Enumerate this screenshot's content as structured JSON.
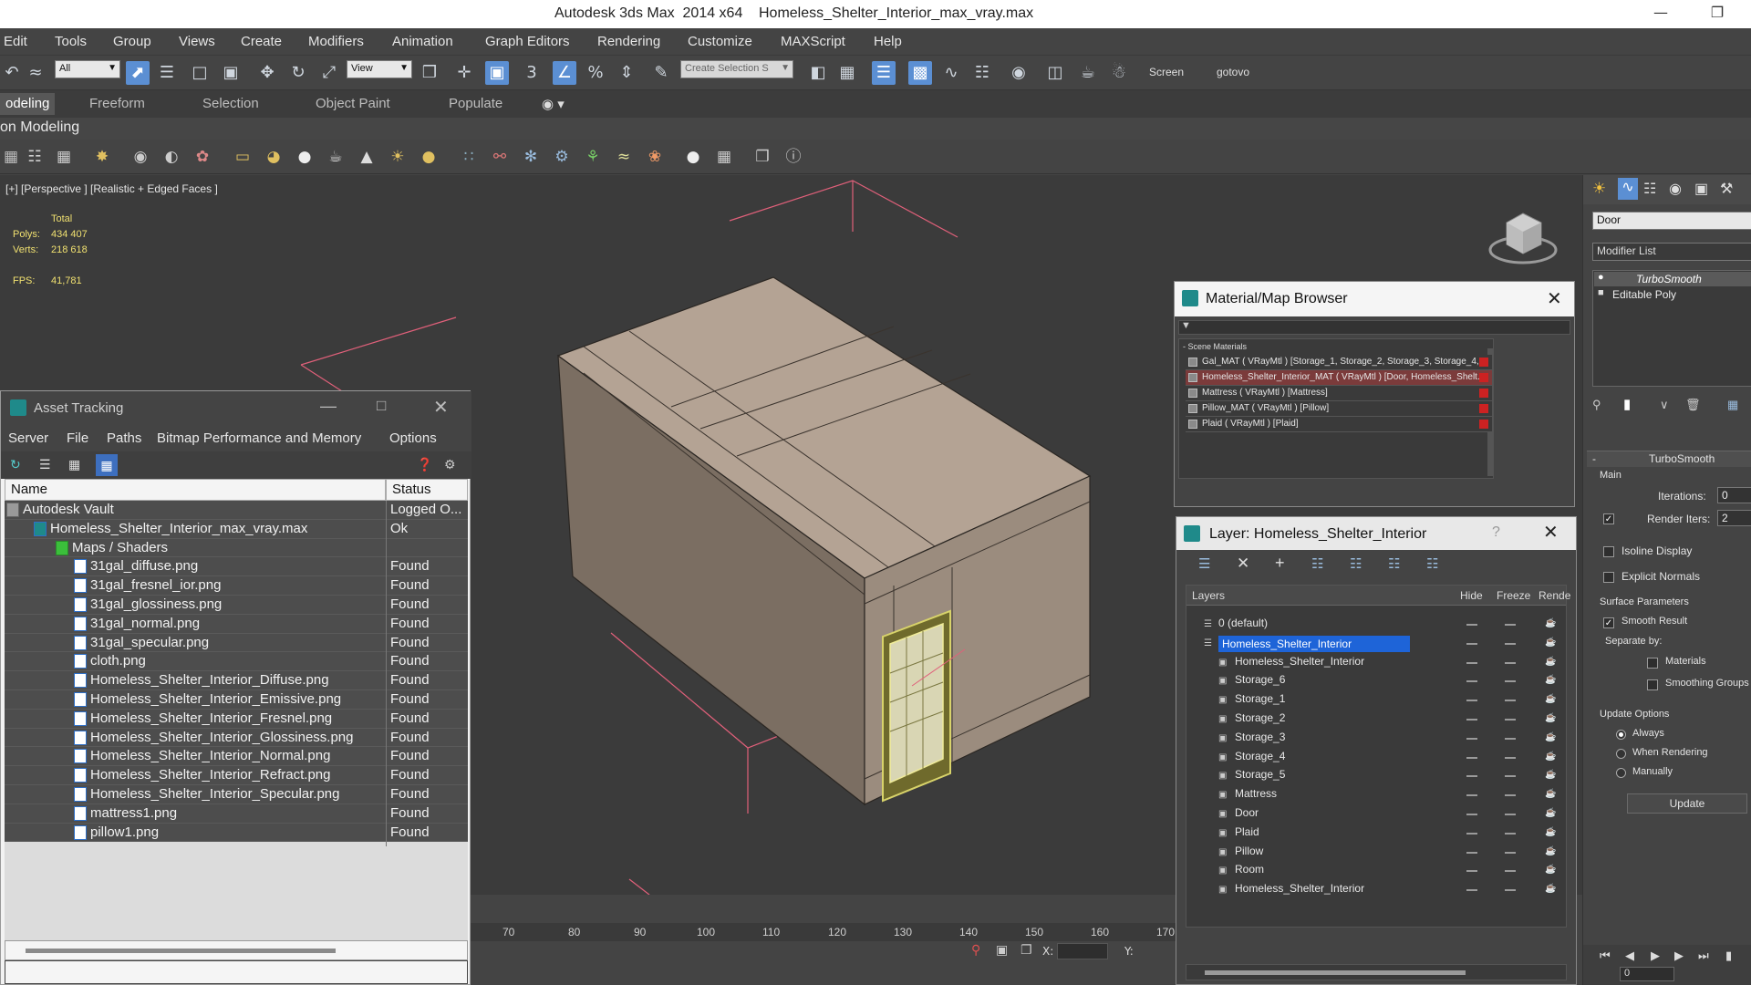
{
  "window": {
    "app_title": "Autodesk 3ds Max  2014 x64",
    "file_title": "Homeless_Shelter_Interior_max_vray.max"
  },
  "menu": [
    "Edit",
    "Tools",
    "Group",
    "Views",
    "Create",
    "Modifiers",
    "Animation",
    "Graph Editors",
    "Rendering",
    "Customize",
    "MAXScript",
    "Help"
  ],
  "toolbar": {
    "filter_value": "All",
    "refcoord_value": "View",
    "selection_set_placeholder": "Create Selection S",
    "screen_label": "Screen",
    "gotovo_label": "gotovo"
  },
  "ribbon": {
    "tabs": [
      "odeling",
      "Freeform",
      "Selection",
      "Object Paint",
      "Populate"
    ],
    "subtitle": "on Modeling"
  },
  "viewport": {
    "label": "[+] [Perspective ] [Realistic + Edged Faces ]",
    "stats": {
      "total_label": "Total",
      "polys_label": "Polys:",
      "polys_value": "434 407",
      "verts_label": "Verts:",
      "verts_value": "218 618",
      "fps_label": "FPS:",
      "fps_value": "41,781"
    }
  },
  "timeline": {
    "ticks": [
      "70",
      "80",
      "90",
      "100",
      "110",
      "120",
      "130",
      "140",
      "150",
      "160",
      "170"
    ],
    "x_label": "X:",
    "y_label": "Y:"
  },
  "asset_tracking": {
    "title": "Asset Tracking",
    "menu": [
      "Server",
      "File",
      "Paths",
      "Bitmap Performance and Memory",
      "Options"
    ],
    "col_name": "Name",
    "col_status": "Status",
    "rows": [
      {
        "name": "Autodesk Vault",
        "status": "Logged O...",
        "level": 0
      },
      {
        "name": "Homeless_Shelter_Interior_max_vray.max",
        "status": "Ok",
        "level": 1
      },
      {
        "name": "Maps / Shaders",
        "status": "",
        "level": 2
      },
      {
        "name": "31gal_diffuse.png",
        "status": "Found",
        "level": 3
      },
      {
        "name": "31gal_fresnel_ior.png",
        "status": "Found",
        "level": 3
      },
      {
        "name": "31gal_glossiness.png",
        "status": "Found",
        "level": 3
      },
      {
        "name": "31gal_normal.png",
        "status": "Found",
        "level": 3
      },
      {
        "name": "31gal_specular.png",
        "status": "Found",
        "level": 3
      },
      {
        "name": "cloth.png",
        "status": "Found",
        "level": 3
      },
      {
        "name": "Homeless_Shelter_Interior_Diffuse.png",
        "status": "Found",
        "level": 3
      },
      {
        "name": "Homeless_Shelter_Interior_Emissive.png",
        "status": "Found",
        "level": 3
      },
      {
        "name": "Homeless_Shelter_Interior_Fresnel.png",
        "status": "Found",
        "level": 3
      },
      {
        "name": "Homeless_Shelter_Interior_Glossiness.png",
        "status": "Found",
        "level": 3
      },
      {
        "name": "Homeless_Shelter_Interior_Normal.png",
        "status": "Found",
        "level": 3
      },
      {
        "name": "Homeless_Shelter_Interior_Refract.png",
        "status": "Found",
        "level": 3
      },
      {
        "name": "Homeless_Shelter_Interior_Specular.png",
        "status": "Found",
        "level": 3
      },
      {
        "name": "mattress1.png",
        "status": "Found",
        "level": 3
      },
      {
        "name": "pillow1.png",
        "status": "Found",
        "level": 3
      }
    ]
  },
  "material_browser": {
    "title": "Material/Map Browser",
    "section": "- Scene Materials",
    "items": [
      "Gal_MAT ( VRayMtl ) [Storage_1, Storage_2, Storage_3, Storage_4,...",
      "Homeless_Shelter_Interior_MAT ( VRayMtl ) [Door, Homeless_Shelt...",
      "Mattress ( VRayMtl ) [Mattress]",
      "Pillow_MAT ( VRayMtl ) [Pillow]",
      "Plaid ( VRayMtl ) [Plaid]"
    ]
  },
  "layer_window": {
    "title": "Layer: Homeless_Shelter_Interior",
    "help": "?",
    "col_layers": "Layers",
    "col_hide": "Hide",
    "col_freeze": "Freeze",
    "col_render": "Rende",
    "rows": [
      {
        "name": "0 (default)",
        "level": 0
      },
      {
        "name": "Homeless_Shelter_Interior",
        "level": 0
      },
      {
        "name": "Homeless_Shelter_Interior",
        "level": 1
      },
      {
        "name": "Storage_6",
        "level": 1
      },
      {
        "name": "Storage_1",
        "level": 1
      },
      {
        "name": "Storage_2",
        "level": 1
      },
      {
        "name": "Storage_3",
        "level": 1
      },
      {
        "name": "Storage_4",
        "level": 1
      },
      {
        "name": "Storage_5",
        "level": 1
      },
      {
        "name": "Mattress",
        "level": 1
      },
      {
        "name": "Door",
        "level": 1
      },
      {
        "name": "Plaid",
        "level": 1
      },
      {
        "name": "Pillow",
        "level": 1
      },
      {
        "name": "Room",
        "level": 1
      },
      {
        "name": "Homeless_Shelter_Interior",
        "level": 1
      }
    ]
  },
  "command_panel": {
    "object_name": "Door",
    "modifier_list": "Modifier List",
    "stack": [
      "TurboSmooth",
      "Editable Poly"
    ],
    "rollout_title": "TurboSmooth",
    "main_label": "Main",
    "iterations_label": "Iterations:",
    "iterations_value": "0",
    "render_iters_label": "Render Iters:",
    "render_iters_value": "2",
    "isoline_label": "Isoline Display",
    "explicit_normals_label": "Explicit Normals",
    "surface_params_label": "Surface Parameters",
    "smooth_result_label": "Smooth Result",
    "separate_by_label": "Separate by:",
    "materials_label": "Materials",
    "smoothing_groups_label": "Smoothing Groups",
    "update_options_label": "Update Options",
    "always_label": "Always",
    "when_rendering_label": "When Rendering",
    "manually_label": "Manually",
    "update_button": "Update",
    "frame_value": "0"
  },
  "colors": {
    "accent": "#5b8fd3",
    "selection": "#1e64d8",
    "stat_text": "#f0e070",
    "box_face": "#b6a596"
  }
}
